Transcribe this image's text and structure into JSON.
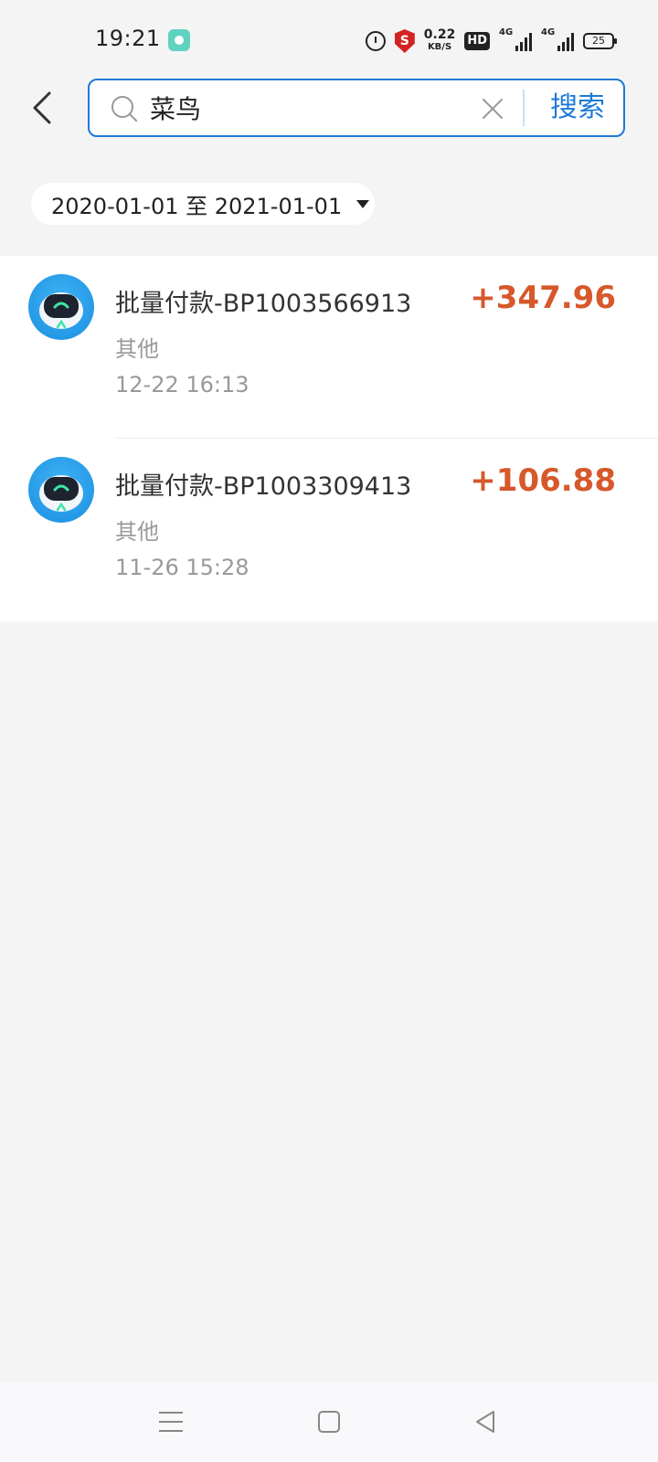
{
  "status_bar": {
    "time": "19:21",
    "net_speed_value": "0.22",
    "net_speed_unit": "KB/S",
    "hd_label": "HD",
    "signal1_label": "4G",
    "signal2_label": "4G",
    "battery_level": "25",
    "icons": [
      "alarm-icon",
      "security-shield-icon",
      "signal-icon",
      "battery-icon"
    ]
  },
  "search": {
    "query": "菜鸟",
    "button_label": "搜索"
  },
  "filter": {
    "date_range": "2020-01-01 至 2021-01-01"
  },
  "transactions": [
    {
      "title": "批量付款-BP1003566913",
      "category": "其他",
      "time": "12-22 16:13",
      "amount": "+347.96"
    },
    {
      "title": "批量付款-BP1003309413",
      "category": "其他",
      "time": "11-26 15:28",
      "amount": "+106.88"
    }
  ],
  "colors": {
    "accent": "#1e7ad6",
    "amount_positive": "#d6582b",
    "background": "#f4f4f5"
  }
}
